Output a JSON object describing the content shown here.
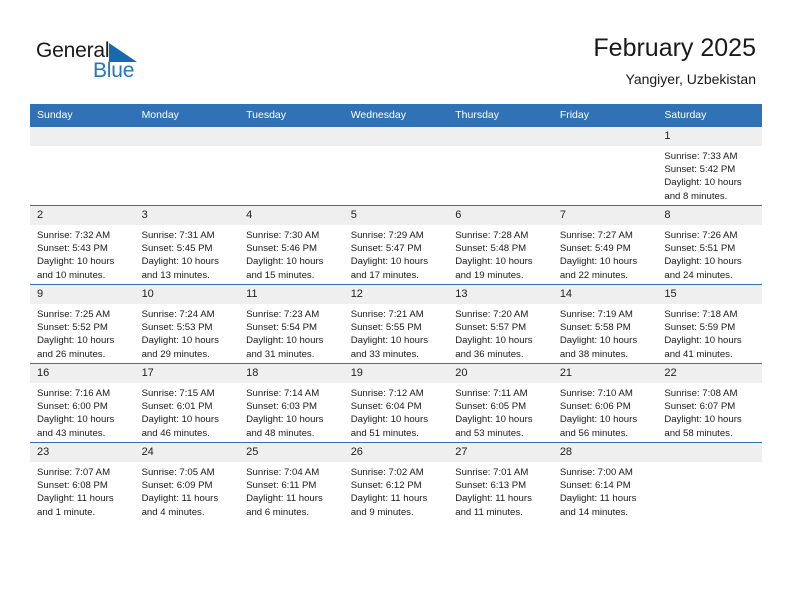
{
  "brand": {
    "name_top": "General",
    "name_bottom": "Blue",
    "accent_color": "#1f78c1",
    "triangle_color": "#1769b0"
  },
  "header": {
    "title": "February 2025",
    "subtitle": "Yangiyer, Uzbekistan"
  },
  "calendar": {
    "header_bg": "#3072b5",
    "daynum_bg": "#efefef",
    "weekdays": [
      "Sunday",
      "Monday",
      "Tuesday",
      "Wednesday",
      "Thursday",
      "Friday",
      "Saturday"
    ],
    "weeks": [
      [
        {
          "day": "",
          "sunrise": "",
          "sunset": "",
          "daylight": "",
          "empty": true
        },
        {
          "day": "",
          "sunrise": "",
          "sunset": "",
          "daylight": "",
          "empty": true
        },
        {
          "day": "",
          "sunrise": "",
          "sunset": "",
          "daylight": "",
          "empty": true
        },
        {
          "day": "",
          "sunrise": "",
          "sunset": "",
          "daylight": "",
          "empty": true
        },
        {
          "day": "",
          "sunrise": "",
          "sunset": "",
          "daylight": "",
          "empty": true
        },
        {
          "day": "",
          "sunrise": "",
          "sunset": "",
          "daylight": "",
          "empty": true
        },
        {
          "day": "1",
          "sunrise": "Sunrise: 7:33 AM",
          "sunset": "Sunset: 5:42 PM",
          "daylight": "Daylight: 10 hours and 8 minutes.",
          "empty": false
        }
      ],
      [
        {
          "day": "2",
          "sunrise": "Sunrise: 7:32 AM",
          "sunset": "Sunset: 5:43 PM",
          "daylight": "Daylight: 10 hours and 10 minutes.",
          "empty": false
        },
        {
          "day": "3",
          "sunrise": "Sunrise: 7:31 AM",
          "sunset": "Sunset: 5:45 PM",
          "daylight": "Daylight: 10 hours and 13 minutes.",
          "empty": false
        },
        {
          "day": "4",
          "sunrise": "Sunrise: 7:30 AM",
          "sunset": "Sunset: 5:46 PM",
          "daylight": "Daylight: 10 hours and 15 minutes.",
          "empty": false
        },
        {
          "day": "5",
          "sunrise": "Sunrise: 7:29 AM",
          "sunset": "Sunset: 5:47 PM",
          "daylight": "Daylight: 10 hours and 17 minutes.",
          "empty": false
        },
        {
          "day": "6",
          "sunrise": "Sunrise: 7:28 AM",
          "sunset": "Sunset: 5:48 PM",
          "daylight": "Daylight: 10 hours and 19 minutes.",
          "empty": false
        },
        {
          "day": "7",
          "sunrise": "Sunrise: 7:27 AM",
          "sunset": "Sunset: 5:49 PM",
          "daylight": "Daylight: 10 hours and 22 minutes.",
          "empty": false
        },
        {
          "day": "8",
          "sunrise": "Sunrise: 7:26 AM",
          "sunset": "Sunset: 5:51 PM",
          "daylight": "Daylight: 10 hours and 24 minutes.",
          "empty": false
        }
      ],
      [
        {
          "day": "9",
          "sunrise": "Sunrise: 7:25 AM",
          "sunset": "Sunset: 5:52 PM",
          "daylight": "Daylight: 10 hours and 26 minutes.",
          "empty": false
        },
        {
          "day": "10",
          "sunrise": "Sunrise: 7:24 AM",
          "sunset": "Sunset: 5:53 PM",
          "daylight": "Daylight: 10 hours and 29 minutes.",
          "empty": false
        },
        {
          "day": "11",
          "sunrise": "Sunrise: 7:23 AM",
          "sunset": "Sunset: 5:54 PM",
          "daylight": "Daylight: 10 hours and 31 minutes.",
          "empty": false
        },
        {
          "day": "12",
          "sunrise": "Sunrise: 7:21 AM",
          "sunset": "Sunset: 5:55 PM",
          "daylight": "Daylight: 10 hours and 33 minutes.",
          "empty": false
        },
        {
          "day": "13",
          "sunrise": "Sunrise: 7:20 AM",
          "sunset": "Sunset: 5:57 PM",
          "daylight": "Daylight: 10 hours and 36 minutes.",
          "empty": false
        },
        {
          "day": "14",
          "sunrise": "Sunrise: 7:19 AM",
          "sunset": "Sunset: 5:58 PM",
          "daylight": "Daylight: 10 hours and 38 minutes.",
          "empty": false
        },
        {
          "day": "15",
          "sunrise": "Sunrise: 7:18 AM",
          "sunset": "Sunset: 5:59 PM",
          "daylight": "Daylight: 10 hours and 41 minutes.",
          "empty": false
        }
      ],
      [
        {
          "day": "16",
          "sunrise": "Sunrise: 7:16 AM",
          "sunset": "Sunset: 6:00 PM",
          "daylight": "Daylight: 10 hours and 43 minutes.",
          "empty": false
        },
        {
          "day": "17",
          "sunrise": "Sunrise: 7:15 AM",
          "sunset": "Sunset: 6:01 PM",
          "daylight": "Daylight: 10 hours and 46 minutes.",
          "empty": false
        },
        {
          "day": "18",
          "sunrise": "Sunrise: 7:14 AM",
          "sunset": "Sunset: 6:03 PM",
          "daylight": "Daylight: 10 hours and 48 minutes.",
          "empty": false
        },
        {
          "day": "19",
          "sunrise": "Sunrise: 7:12 AM",
          "sunset": "Sunset: 6:04 PM",
          "daylight": "Daylight: 10 hours and 51 minutes.",
          "empty": false
        },
        {
          "day": "20",
          "sunrise": "Sunrise: 7:11 AM",
          "sunset": "Sunset: 6:05 PM",
          "daylight": "Daylight: 10 hours and 53 minutes.",
          "empty": false
        },
        {
          "day": "21",
          "sunrise": "Sunrise: 7:10 AM",
          "sunset": "Sunset: 6:06 PM",
          "daylight": "Daylight: 10 hours and 56 minutes.",
          "empty": false
        },
        {
          "day": "22",
          "sunrise": "Sunrise: 7:08 AM",
          "sunset": "Sunset: 6:07 PM",
          "daylight": "Daylight: 10 hours and 58 minutes.",
          "empty": false
        }
      ],
      [
        {
          "day": "23",
          "sunrise": "Sunrise: 7:07 AM",
          "sunset": "Sunset: 6:08 PM",
          "daylight": "Daylight: 11 hours and 1 minute.",
          "empty": false
        },
        {
          "day": "24",
          "sunrise": "Sunrise: 7:05 AM",
          "sunset": "Sunset: 6:09 PM",
          "daylight": "Daylight: 11 hours and 4 minutes.",
          "empty": false
        },
        {
          "day": "25",
          "sunrise": "Sunrise: 7:04 AM",
          "sunset": "Sunset: 6:11 PM",
          "daylight": "Daylight: 11 hours and 6 minutes.",
          "empty": false
        },
        {
          "day": "26",
          "sunrise": "Sunrise: 7:02 AM",
          "sunset": "Sunset: 6:12 PM",
          "daylight": "Daylight: 11 hours and 9 minutes.",
          "empty": false
        },
        {
          "day": "27",
          "sunrise": "Sunrise: 7:01 AM",
          "sunset": "Sunset: 6:13 PM",
          "daylight": "Daylight: 11 hours and 11 minutes.",
          "empty": false
        },
        {
          "day": "28",
          "sunrise": "Sunrise: 7:00 AM",
          "sunset": "Sunset: 6:14 PM",
          "daylight": "Daylight: 11 hours and 14 minutes.",
          "empty": false
        },
        {
          "day": "",
          "sunrise": "",
          "sunset": "",
          "daylight": "",
          "empty": true
        }
      ]
    ]
  }
}
